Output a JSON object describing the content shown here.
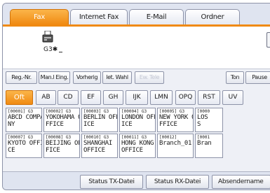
{
  "tabs": [
    {
      "label": "Fax",
      "active": true
    },
    {
      "label": "Internet Fax",
      "active": false
    },
    {
      "label": "E-Mail",
      "active": false
    },
    {
      "label": "Ordner",
      "active": false
    }
  ],
  "status": {
    "device_icon": "fax-machine-icon",
    "destination_label": "G3"
  },
  "buttons": {
    "reg_nr": "Reg.-Nr.",
    "manual_eing": "Man.l Eing.",
    "vorherig": "Vorherig",
    "letzte_wahl": "let. Wahl",
    "disabled_btn": "Ew. Tele",
    "ton": "Ton",
    "pause": "Pause"
  },
  "index_tabs": [
    "Oft",
    "AB",
    "CD",
    "EF",
    "GH",
    "IJK",
    "LMN",
    "OPQ",
    "RST",
    "UV"
  ],
  "destinations": [
    {
      "code": "[00001] G3",
      "name": "ABCD COMPA\nNY"
    },
    {
      "code": "[00002] G3",
      "name": "YOKOHAMA O\nFFICE"
    },
    {
      "code": "[00003] G3",
      "name": "BERLIN OFF\nICE"
    },
    {
      "code": "[00004] G3",
      "name": "LONDON OFF\nICE"
    },
    {
      "code": "[00005] G3",
      "name": "NEW YORK O\nFFICE"
    },
    {
      "code": "[0000",
      "name": "LOS\nS"
    },
    {
      "code": "[00007] G3",
      "name": "KYOTO OFFI\nCE"
    },
    {
      "code": "[00008] G3",
      "name": "BEIJING OF\nFICE"
    },
    {
      "code": "[00010] G3",
      "name": "SHANGHAI\nOFFICE"
    },
    {
      "code": "[00011] G3",
      "name": "HONG KONG\nOFFICE"
    },
    {
      "code": "[00012]",
      "name": "Branch_01"
    },
    {
      "code": "[0001",
      "name": "Bran"
    }
  ],
  "bottom": {
    "status_tx": "Status TX-Datei",
    "status_rx": "Status RX-Datei",
    "absender": "Absendername"
  }
}
